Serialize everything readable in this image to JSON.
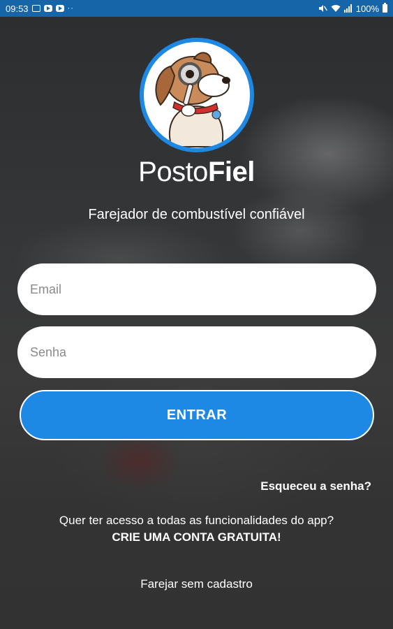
{
  "status_bar": {
    "time": "09:53",
    "dots": "··",
    "battery_text": "100%",
    "color": "#1565a8"
  },
  "logo": {
    "icon": "dog-with-magnifier-logo",
    "brand_light": "Posto",
    "brand_bold": "Fiel",
    "ring_color": "#1e88e5"
  },
  "tagline": "Farejador de combustível confiável",
  "login_form": {
    "email_placeholder": "Email",
    "email_value": "",
    "password_placeholder": "Senha",
    "password_value": "",
    "submit_label": "ENTRAR",
    "submit_color": "#1e88e5"
  },
  "links": {
    "forgot_password": "Esqueceu a senha?",
    "signup_question": "Quer ter acesso a todas as funcionalidades do app?",
    "signup_cta": "CRIE UMA CONTA GRATUITA!",
    "guest": "Farejar sem cadastro"
  }
}
